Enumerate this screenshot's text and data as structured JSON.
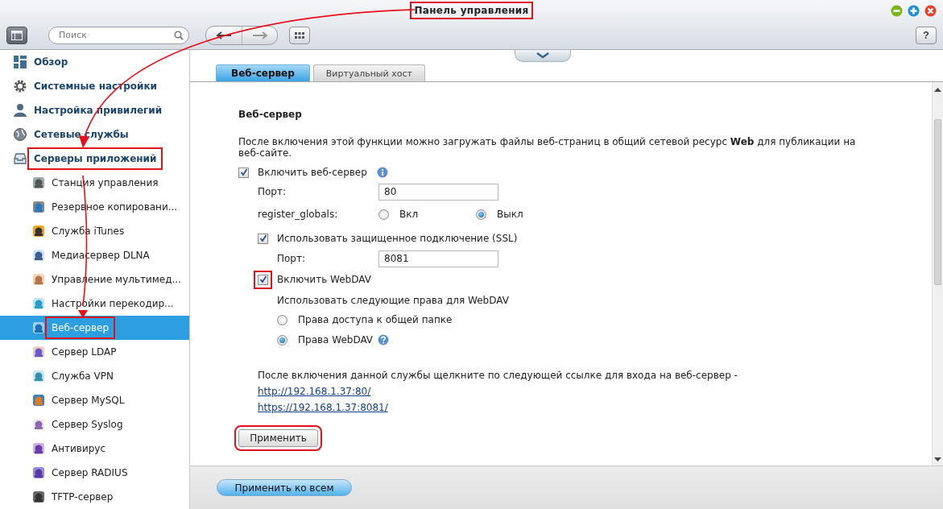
{
  "window": {
    "title": "Панель управления",
    "title_highlighted": true
  },
  "toolbar": {
    "search": {
      "placeholder": "Поиск"
    },
    "help": "?"
  },
  "sidebar": {
    "items": [
      {
        "label": "Обзор",
        "selected": false
      },
      {
        "label": "Системные настройки",
        "selected": false
      },
      {
        "label": "Настройка привилегий",
        "selected": false
      },
      {
        "label": "Сетевые службы",
        "selected": false
      },
      {
        "label": "Серверы приложений",
        "selected": false,
        "highlighted": true,
        "children": [
          {
            "label": "Станция управления",
            "selected": false
          },
          {
            "label": "Резервное копировани...",
            "selected": false
          },
          {
            "label": "Служба iTunes",
            "selected": false
          },
          {
            "label": "Медиасервер DLNA",
            "selected": false
          },
          {
            "label": "Управление мультимед...",
            "selected": false
          },
          {
            "label": "Настройки перекодир...",
            "selected": false
          },
          {
            "label": "Веб-сервер",
            "selected": true,
            "highlighted": true
          },
          {
            "label": "Сервер LDAP",
            "selected": false
          },
          {
            "label": "Служба VPN",
            "selected": false
          },
          {
            "label": "Сервер MySQL",
            "selected": false
          },
          {
            "label": "Сервер Syslog",
            "selected": false
          },
          {
            "label": "Антивирус",
            "selected": false
          },
          {
            "label": "Сервер RADIUS",
            "selected": false
          },
          {
            "label": "TFTP-сервер",
            "selected": false
          }
        ]
      }
    ]
  },
  "tabs": [
    {
      "label": "Веб-сервер",
      "selected": true
    },
    {
      "label": "Виртуальный хост",
      "selected": false
    }
  ],
  "section": {
    "heading": "Веб-сервер",
    "description": "После включения этой функции можно загружать файлы веб-страниц в общий сетевой ресурс **Web** для публикации на веб-сайте.",
    "enable_web_server": {
      "label": "Включить веб-сервер",
      "checked": true
    },
    "port": {
      "label": "Порт:",
      "value": "80"
    },
    "register_globals": {
      "label": "register_globals:",
      "options": [
        {
          "label": "Вкл",
          "selected": false
        },
        {
          "label": "Выкл",
          "selected": true
        }
      ]
    },
    "ssl": {
      "label": "Использовать защищенное подключение (SSL)",
      "checked": true
    },
    "ssl_port": {
      "label": "Порт:",
      "value": "8081"
    },
    "webdav": {
      "label": "Включить WebDAV",
      "checked": true,
      "highlighted": true
    },
    "webdav_rights": {
      "label": "Использовать следующие права для WebDAV",
      "options": [
        {
          "label": "Права доступа к общей папке",
          "selected": false
        },
        {
          "label": "Права WebDAV",
          "selected": true
        }
      ]
    },
    "links_note": "После включения данной службы щелкните по следующей ссылке для входа на веб-сервер -",
    "links": [
      "http://192.168.1.37:80/",
      "https://192.168.1.37:8081/"
    ],
    "apply_button": {
      "label": "Применить",
      "highlighted": true
    }
  },
  "footer": {
    "apply_all_button": "Применить ко всем"
  }
}
